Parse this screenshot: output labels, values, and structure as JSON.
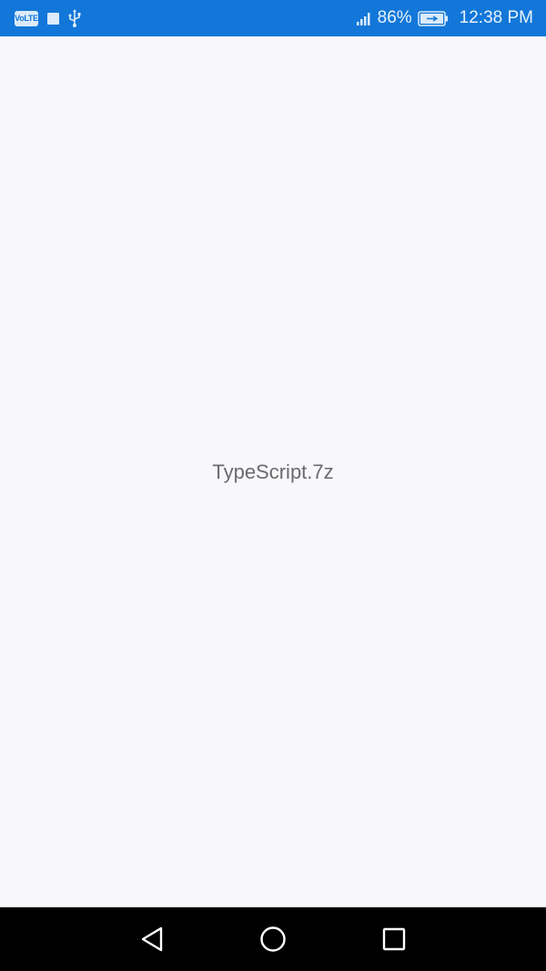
{
  "status_bar": {
    "volte_label": "VoLTE",
    "battery_percent": "86%",
    "time": "12:38 PM",
    "icons": [
      "volte-icon",
      "notification-square-icon",
      "usb-icon",
      "signal-icon",
      "battery-charging-icon"
    ],
    "background_color": "#1277d9"
  },
  "main": {
    "file_name": "TypeScript.7z",
    "background_color": "#f8f7f9"
  },
  "nav_bar": {
    "buttons": [
      "back-icon",
      "home-icon",
      "recents-icon"
    ],
    "background_color": "#000000"
  }
}
